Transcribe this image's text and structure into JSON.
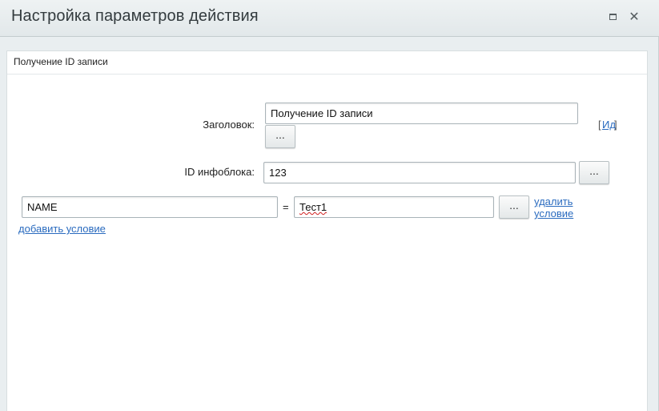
{
  "window": {
    "title": "Настройка параметров действия",
    "maximize_icon": "maximize-icon",
    "close_icon": "close-icon",
    "close_glyph": "✕"
  },
  "section": {
    "title": "Получение ID записи"
  },
  "fields": {
    "title_label": "Заголовок:",
    "title_value": "Получение ID записи",
    "title_button": "...",
    "id_link": "Ид",
    "bracket_open": "[",
    "bracket_close": "]",
    "iblock_label": "ID инфоблока:",
    "iblock_value": "123",
    "iblock_button": "..."
  },
  "conditions": [
    {
      "field": "NAME",
      "operator": "=",
      "value": "Тест1",
      "button": "...",
      "delete_line1": "удалить",
      "delete_line2": "условие"
    }
  ],
  "add_condition": "добавить условие"
}
